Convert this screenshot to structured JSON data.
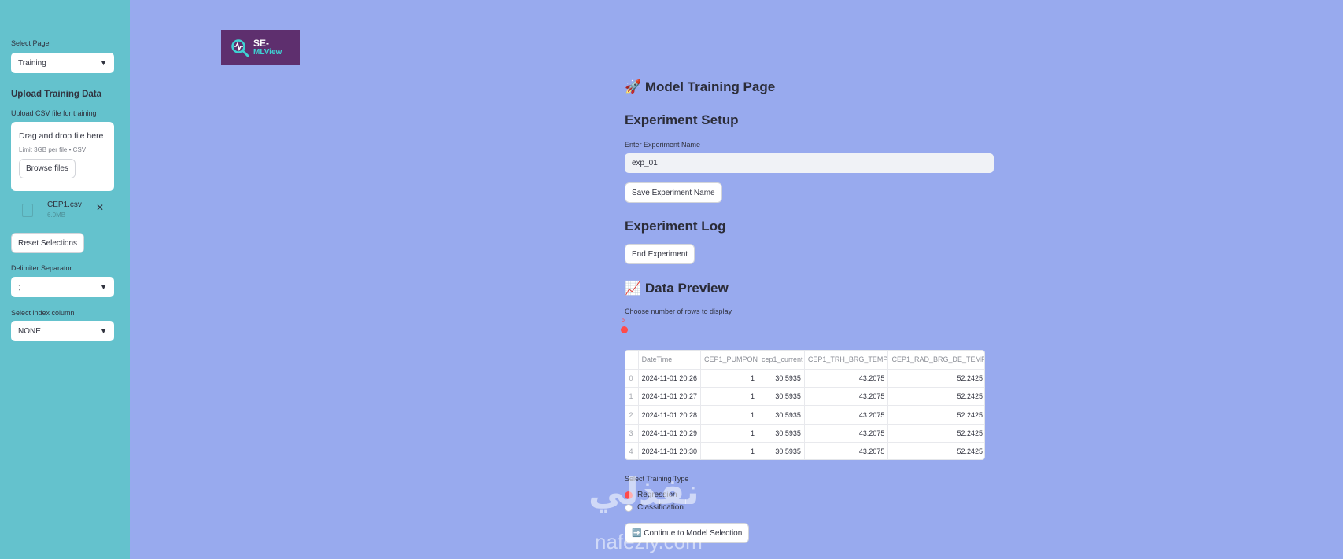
{
  "sidebar": {
    "select_page_label": "Select Page",
    "select_page_value": "Training",
    "upload_heading": "Upload Training Data",
    "upload_label": "Upload CSV file for training",
    "dropzone_title": "Drag and drop file here",
    "dropzone_limit": "Limit 3GB per file • CSV",
    "browse_label": "Browse files",
    "file_name": "CEP1.csv",
    "file_size": "6.0MB",
    "reset_label": "Reset Selections",
    "delimiter_label": "Delimiter Separator",
    "delimiter_value": ";",
    "index_label": "Select index column",
    "index_value": "NONE"
  },
  "logo": {
    "line1": "SE-",
    "line2": "MLView"
  },
  "main": {
    "page_title": "🚀 Model Training Page",
    "setup_heading": "Experiment Setup",
    "exp_name_label": "Enter Experiment Name",
    "exp_name_value": "exp_01",
    "save_label": "Save Experiment Name",
    "log_heading": "Experiment Log",
    "end_label": "End Experiment",
    "preview_heading": "📈 Data Preview",
    "rows_label": "Choose number of rows to display",
    "rows_value": "5",
    "table": {
      "headers": [
        "",
        "DateTime",
        "CEP1_PUMPON",
        "cep1_current",
        "CEP1_TRH_BRG_TEMP",
        "CEP1_RAD_BRG_DE_TEMP"
      ],
      "rows": [
        [
          "0",
          "2024-11-01 20:26",
          "1",
          "30.5935",
          "43.2075",
          "52.2425"
        ],
        [
          "1",
          "2024-11-01 20:27",
          "1",
          "30.5935",
          "43.2075",
          "52.2425"
        ],
        [
          "2",
          "2024-11-01 20:28",
          "1",
          "30.5935",
          "43.2075",
          "52.2425"
        ],
        [
          "3",
          "2024-11-01 20:29",
          "1",
          "30.5935",
          "43.2075",
          "52.2425"
        ],
        [
          "4",
          "2024-11-01 20:30",
          "1",
          "30.5935",
          "43.2075",
          "52.2425"
        ]
      ]
    },
    "training_type_label": "Select Training Type",
    "options": [
      "Regression",
      "Classification"
    ],
    "continue_label": "➡️ Continue to Model Selection"
  },
  "watermark": {
    "arabic": "نفذلي",
    "latin": "nafezly.com"
  }
}
